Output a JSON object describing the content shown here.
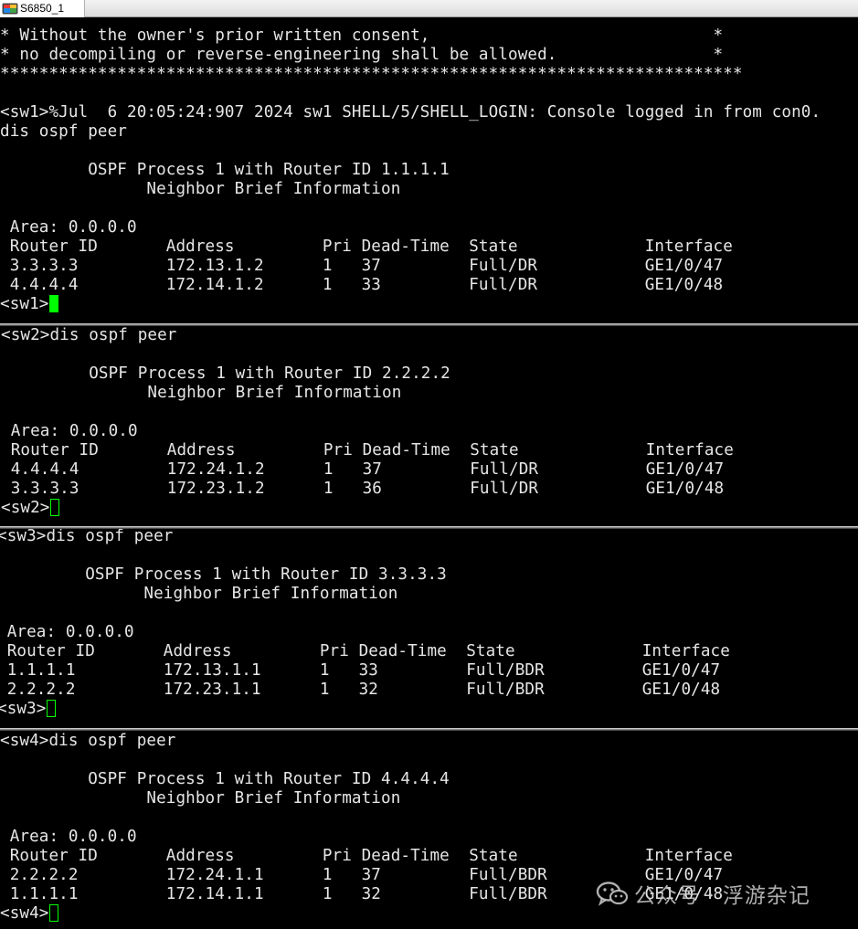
{
  "window": {
    "tab_title": "S6850_1",
    "accent_color": "#00ff00"
  },
  "panes": [
    {
      "id": "sw1",
      "lines": [
        "* Without the owner's prior written consent,                             *",
        "* no decompiling or reverse-engineering shall be allowed.                *",
        "****************************************************************************",
        "",
        "<sw1>%Jul  6 20:05:24:907 2024 sw1 SHELL/5/SHELL_LOGIN: Console logged in from con0.",
        "dis ospf peer",
        "",
        "         OSPF Process 1 with Router ID 1.1.1.1",
        "               Neighbor Brief Information",
        "",
        " Area: 0.0.0.0",
        " Router ID       Address         Pri Dead-Time  State             Interface",
        " 3.3.3.3         172.13.1.2      1   37         Full/DR           GE1/0/47",
        " 4.4.4.4         172.14.1.2      1   33         Full/DR           GE1/0/48"
      ],
      "prompt": "<sw1>",
      "cursor": "filled"
    },
    {
      "id": "sw2",
      "lines": [
        "<sw2>dis ospf peer",
        "",
        "         OSPF Process 1 with Router ID 2.2.2.2",
        "               Neighbor Brief Information",
        "",
        " Area: 0.0.0.0",
        " Router ID       Address         Pri Dead-Time  State             Interface",
        " 4.4.4.4         172.24.1.2      1   37         Full/DR           GE1/0/47",
        " 3.3.3.3         172.23.1.2      1   36         Full/DR           GE1/0/48"
      ],
      "prompt": "<sw2>",
      "cursor": "hollow"
    },
    {
      "id": "sw3",
      "lines": [
        "<sw3>dis ospf peer",
        "",
        "         OSPF Process 1 with Router ID 3.3.3.3",
        "               Neighbor Brief Information",
        "",
        " Area: 0.0.0.0",
        " Router ID       Address         Pri Dead-Time  State             Interface",
        " 1.1.1.1         172.13.1.1      1   33         Full/BDR          GE1/0/47",
        " 2.2.2.2         172.23.1.1      1   32         Full/BDR          GE1/0/48"
      ],
      "prompt": "<sw3>",
      "cursor": "hollow"
    },
    {
      "id": "sw4",
      "lines": [
        "<sw4>dis ospf peer",
        "",
        "         OSPF Process 1 with Router ID 4.4.4.4",
        "               Neighbor Brief Information",
        "",
        " Area: 0.0.0.0",
        " Router ID       Address         Pri Dead-Time  State             Interface",
        " 2.2.2.2         172.24.1.1      1   37         Full/BDR          GE1/0/47",
        " 1.1.1.1         172.14.1.1      1   32         Full/BDR          GE1/0/48"
      ],
      "prompt": "<sw4>",
      "cursor": "hollow"
    }
  ],
  "watermark": {
    "text": "公众号 · 浮游杂记",
    "icon": "wechat-icon"
  }
}
